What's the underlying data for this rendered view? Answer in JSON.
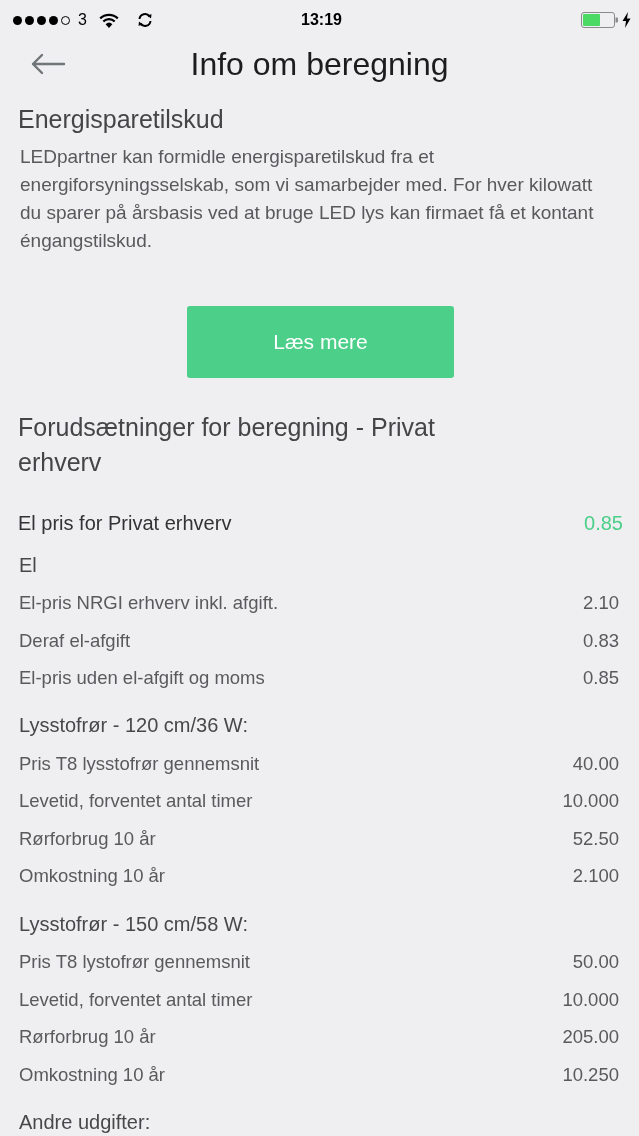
{
  "status_bar": {
    "carrier": "3",
    "time": "13:19"
  },
  "nav": {
    "title": "Info om beregning"
  },
  "intro": {
    "title": "Energisparetilskud",
    "text": "LEDpartner kan formidle energisparetilskud fra et energiforsyningsselskab, som vi samarbejder med. For hver kilowatt du sparer på årsbasis ved at bruge LED lys kan firmaet få et kontant éngangstilskud.",
    "button": "Læs mere"
  },
  "assumptions": {
    "title": "Forudsætninger for beregning - Privat erhverv",
    "highlight": {
      "label": "El pris for Privat erhverv",
      "value": "0.85"
    },
    "groups": [
      {
        "title": "El",
        "rows": [
          {
            "label": "El-pris NRGI erhverv inkl. afgift.",
            "value": "2.10"
          },
          {
            "label": "Deraf el-afgift",
            "value": "0.83"
          },
          {
            "label": "El-pris uden el-afgift og moms",
            "value": "0.85"
          }
        ]
      },
      {
        "title": "Lysstofrør - 120 cm/36 W:",
        "rows": [
          {
            "label": "Pris T8 lysstofrør gennemsnit",
            "value": "40.00"
          },
          {
            "label": "Levetid, forventet antal timer",
            "value": "10.000"
          },
          {
            "label": "Rørforbrug 10 år",
            "value": "52.50"
          },
          {
            "label": "Omkostning 10 år",
            "value": "2.100"
          }
        ]
      },
      {
        "title": "Lysstofrør - 150 cm/58 W:",
        "rows": [
          {
            "label": "Pris T8 lystofrør gennemsnit",
            "value": "50.00"
          },
          {
            "label": "Levetid, forventet antal timer",
            "value": "10.000"
          },
          {
            "label": "Rørforbrug 10 år",
            "value": "205.00"
          },
          {
            "label": "Omkostning 10 år",
            "value": "10.250"
          }
        ]
      },
      {
        "title": "Andre udgifter:"
      }
    ]
  }
}
